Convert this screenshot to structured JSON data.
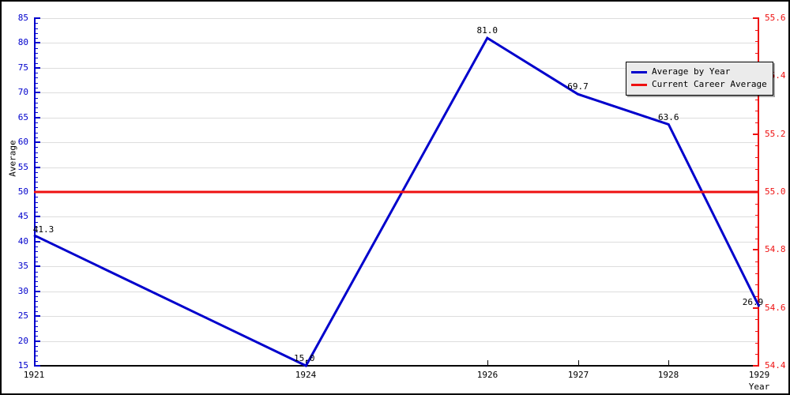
{
  "chart_data": {
    "type": "line",
    "title": "",
    "xlabel": "Year",
    "ylabel": "Average",
    "x": [
      1921,
      1924,
      1926,
      1927,
      1928,
      1929
    ],
    "xticklabels": [
      "1921",
      "1924",
      "1926",
      "1927",
      "1928",
      "1929"
    ],
    "xlim": [
      1921,
      1929
    ],
    "ylim": [
      15,
      85
    ],
    "yticks": [
      15,
      20,
      25,
      30,
      35,
      40,
      45,
      50,
      55,
      60,
      65,
      70,
      75,
      80,
      85
    ],
    "yticklabels": [
      "15",
      "20",
      "25",
      "30",
      "35",
      "40",
      "45",
      "50",
      "55",
      "60",
      "65",
      "70",
      "75",
      "80",
      "85"
    ],
    "y2lim": [
      54.4,
      55.6
    ],
    "y2ticks": [
      54.4,
      54.6,
      54.8,
      55.0,
      55.2,
      55.4,
      55.6
    ],
    "y2ticklabels": [
      "54.4",
      "54.6",
      "54.8",
      "55.0",
      "55.2",
      "55.4",
      "55.6"
    ],
    "grid": true,
    "legend_position": "upper right",
    "series": [
      {
        "name": "Average by Year",
        "color": "#0000CC",
        "type": "line",
        "values": [
          41.3,
          15.0,
          81.0,
          69.7,
          63.6,
          26.9
        ],
        "point_labels": [
          "41.3",
          "15.0",
          "81.0",
          "69.7",
          "63.6",
          "26.9"
        ]
      },
      {
        "name": "Current Career Average",
        "color": "#EE1111",
        "type": "hline",
        "value": 50.0,
        "value_right_axis": 55.0
      }
    ]
  },
  "axes": {
    "left": {
      "title": "Average",
      "color": "#0000CC",
      "ticklabels": [
        "85",
        "80",
        "75",
        "70",
        "65",
        "60",
        "55",
        "50",
        "45",
        "40",
        "35",
        "30",
        "25",
        "20",
        "15"
      ]
    },
    "right": {
      "color": "#EE1111",
      "ticklabels": [
        "55.6",
        "55.4",
        "55.2",
        "55.0",
        "54.8",
        "54.6",
        "54.4"
      ]
    },
    "bottom": {
      "title": "Year",
      "color": "#000000",
      "ticklabels": [
        "1921",
        "1924",
        "1926",
        "1927",
        "1928",
        "1929"
      ]
    }
  },
  "legend": {
    "entries": [
      {
        "label": "Average by Year",
        "color": "#0000CC"
      },
      {
        "label": "Current Career Average",
        "color": "#EE1111"
      }
    ]
  }
}
